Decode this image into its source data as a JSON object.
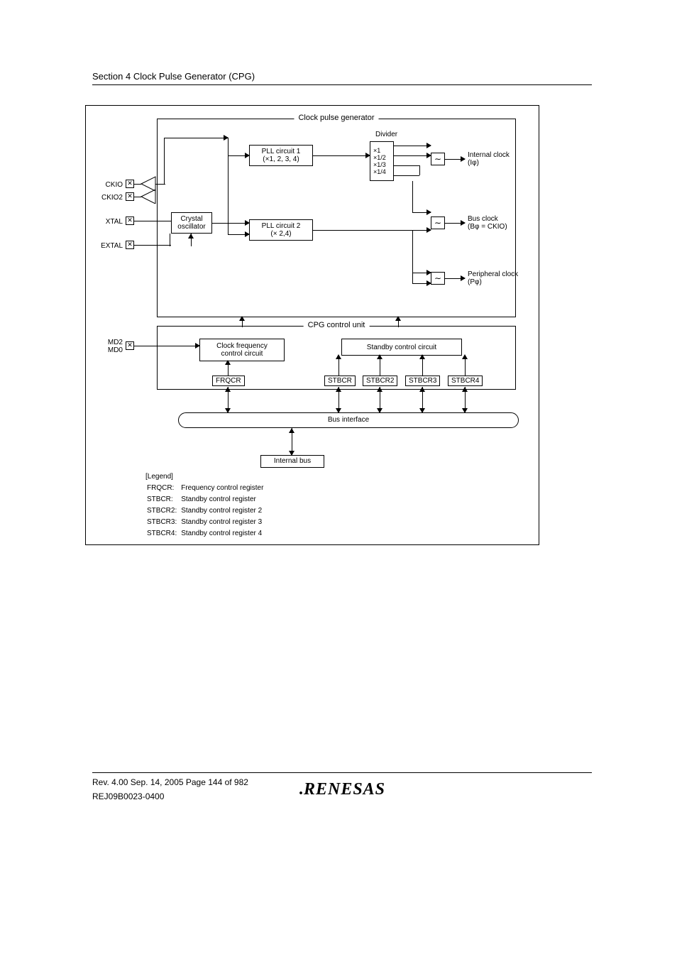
{
  "section_header": "Section 4   Clock Pulse Generator (CPG)",
  "diagram": {
    "top_title": "Clock pulse generator",
    "pins": {
      "ckio": "CKIO",
      "ckio2": "CKIO2",
      "xtal": "XTAL",
      "extal": "EXTAL",
      "md2": "MD2",
      "md0": "MD0"
    },
    "blocks": {
      "pll1_l1": "PLL circuit 1",
      "pll1_l2": "(×1, 2, 3, 4)",
      "pll2_l1": "PLL circuit 2",
      "pll2_l2": "(× 2,4)",
      "xosc_l1": "Crystal",
      "xosc_l2": "oscillator",
      "divider_label": "Divider",
      "div1": "×1",
      "div2": "×1/2",
      "div3": "×1/3",
      "div4": "×1/4"
    },
    "outputs": {
      "internal_l1": "Internal clock",
      "internal_l2": "(Iφ)",
      "bus_l1": "Bus clock",
      "bus_l2": "(Bφ = CKIO)",
      "periph_l1": "Peripheral clock",
      "periph_l2": "(Pφ)"
    },
    "cpu_title": "CPG control unit",
    "cfc_l1": "Clock frequency",
    "cfc_l2": "control circuit",
    "scc": "Standby control circuit",
    "regs": {
      "frqcr": "FRQCR",
      "stbcr": "STBCR",
      "stbcr2": "STBCR2",
      "stbcr3": "STBCR3",
      "stbcr4": "STBCR4"
    },
    "busif": "Bus interface",
    "internal_bus": "Internal bus",
    "legend_title": "[Legend]",
    "legend": [
      {
        "k": "FRQCR:",
        "v": "Frequency control register"
      },
      {
        "k": "STBCR:",
        "v": "Standby control register"
      },
      {
        "k": "STBCR2:",
        "v": "Standby control register 2"
      },
      {
        "k": "STBCR3:",
        "v": "Standby control register 3"
      },
      {
        "k": "STBCR4:",
        "v": "Standby control register 4"
      }
    ]
  },
  "footer": {
    "line1": "Rev. 4.00  Sep. 14, 2005  Page 144 of 982",
    "line2": "REJ09B0023-0400",
    "logo": "RENESAS"
  }
}
